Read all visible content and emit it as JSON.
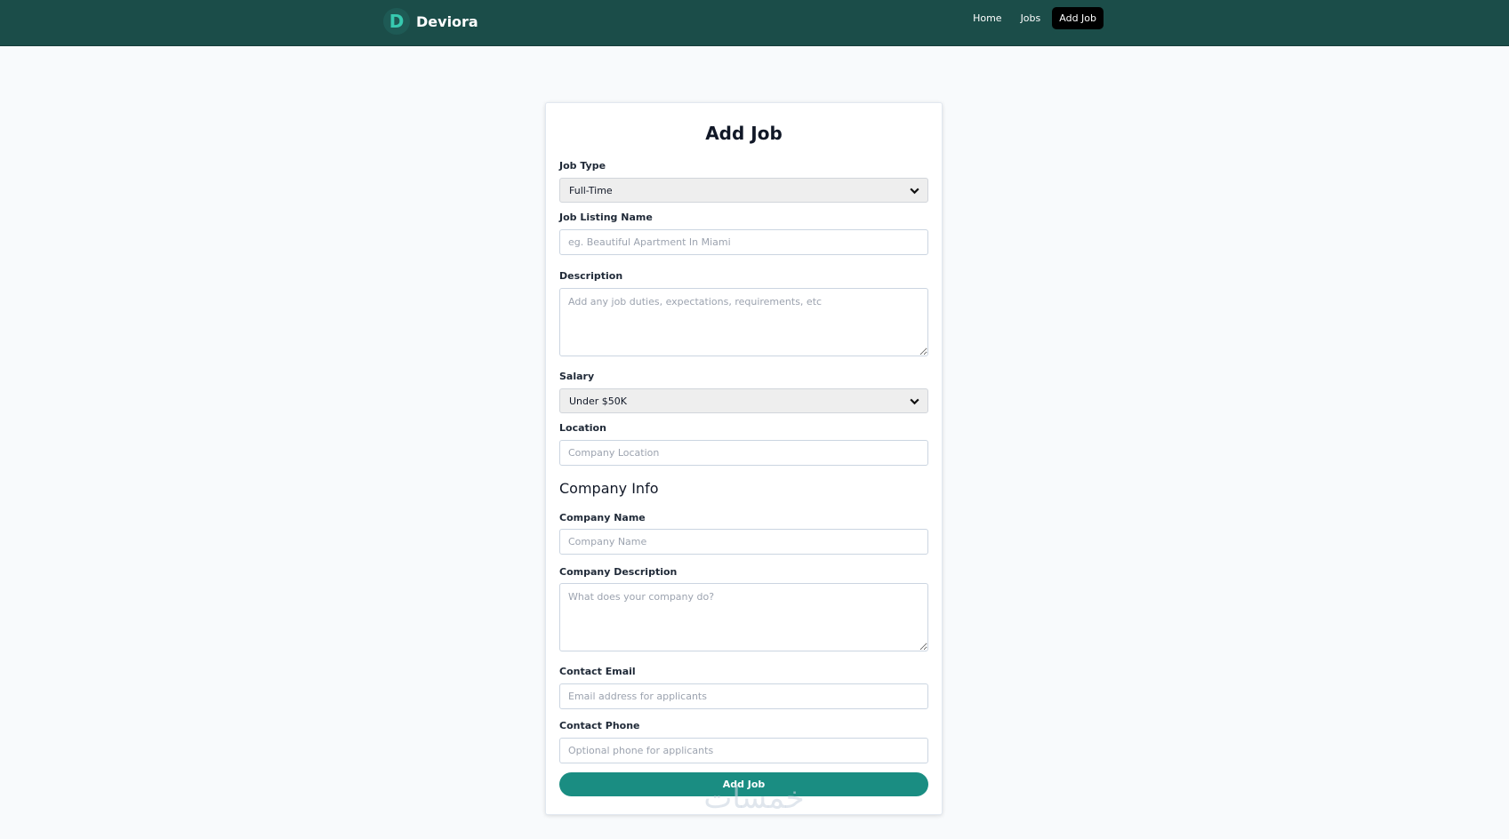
{
  "brand": {
    "logo_letter": "D",
    "name": "Deviora"
  },
  "nav": {
    "items": [
      {
        "label": "Home"
      },
      {
        "label": "Jobs"
      },
      {
        "label": "Add Job"
      }
    ],
    "active": "Add Job"
  },
  "form": {
    "title": "Add Job",
    "job_type": {
      "label": "Job Type",
      "value": "Full-Time"
    },
    "job_listing_name": {
      "label": "Job Listing Name",
      "placeholder": "eg. Beautiful Apartment In Miami"
    },
    "description": {
      "label": "Description",
      "placeholder": "Add any job duties, expectations, requirements, etc"
    },
    "salary": {
      "label": "Salary",
      "value": "Under $50K"
    },
    "location": {
      "label": "Location",
      "placeholder": "Company Location"
    },
    "company_info_title": "Company Info",
    "company_name": {
      "label": "Company Name",
      "placeholder": "Company Name"
    },
    "company_description": {
      "label": "Company Description",
      "placeholder": "What does your company do?"
    },
    "contact_email": {
      "label": "Contact Email",
      "placeholder": "Email address for applicants"
    },
    "contact_phone": {
      "label": "Contact Phone",
      "placeholder": "Optional phone for applicants"
    },
    "submit_label": "Add Job"
  },
  "watermark": {
    "text": "خمسات"
  },
  "colors": {
    "navbar_bg": "#1b4d49",
    "logo_accent": "#37c9b0",
    "submit_bg": "#1a8d82",
    "page_bg": "#f8fafc",
    "active_nav_bg": "#000000"
  }
}
